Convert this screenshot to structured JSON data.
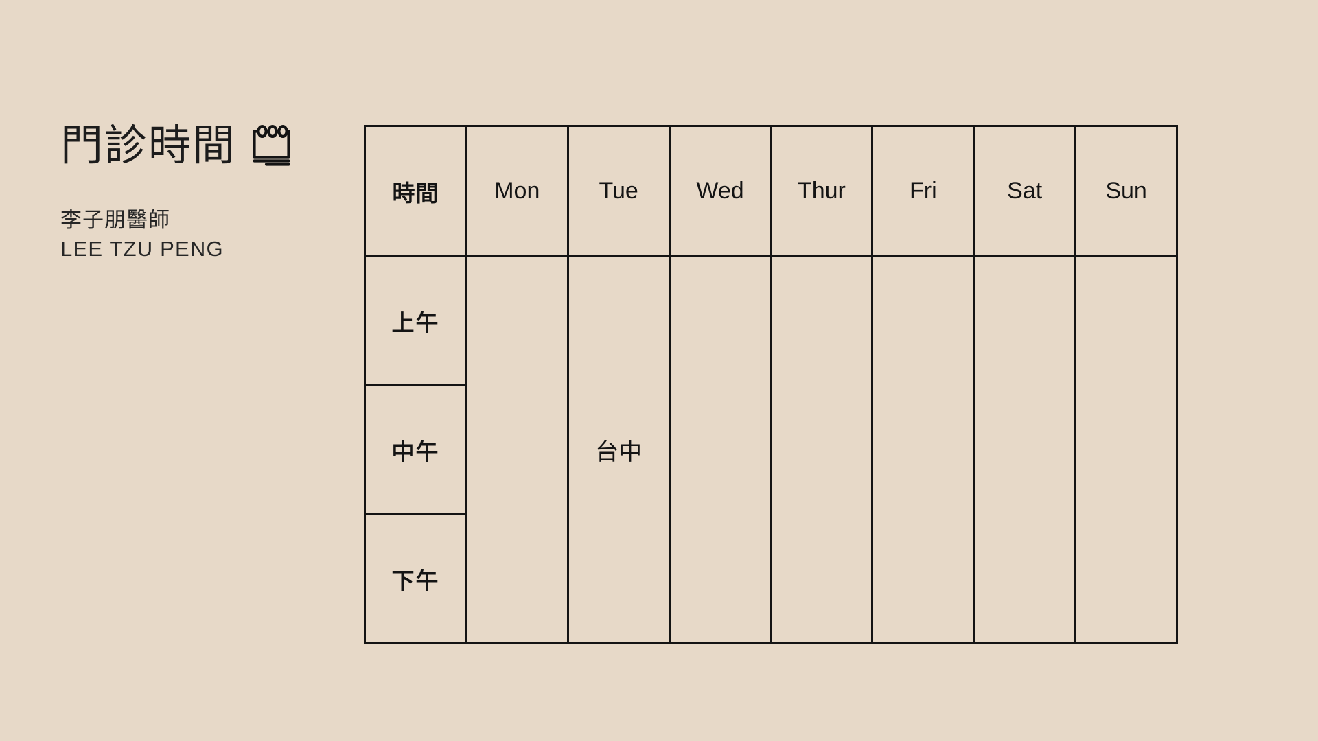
{
  "page": {
    "background_color": "#e7d9c8",
    "ink_color": "#141414"
  },
  "header": {
    "title": "門診時間",
    "icon": "notepad-calendar-icon",
    "doctor_name_zh": "李子朋醫師",
    "doctor_name_en": "LEE TZU PENG"
  },
  "schedule": {
    "columns": [
      {
        "key": "time",
        "label": "時間"
      },
      {
        "key": "mon",
        "label": "Mon"
      },
      {
        "key": "tue",
        "label": "Tue"
      },
      {
        "key": "wed",
        "label": "Wed"
      },
      {
        "key": "thur",
        "label": "Thur"
      },
      {
        "key": "fri",
        "label": "Fri"
      },
      {
        "key": "sat",
        "label": "Sat"
      },
      {
        "key": "sun",
        "label": "Sun"
      }
    ],
    "rows": [
      {
        "label": "上午",
        "cells": {
          "mon": "",
          "tue": "",
          "wed": "",
          "thur": "",
          "fri": "",
          "sat": "",
          "sun": ""
        }
      },
      {
        "label": "中午",
        "cells": {
          "mon": "",
          "tue": "台中",
          "wed": "",
          "thur": "",
          "fri": "",
          "sat": "",
          "sun": ""
        }
      },
      {
        "label": "下午",
        "cells": {
          "mon": "",
          "tue": "",
          "wed": "",
          "thur": "",
          "fri": "",
          "sat": "",
          "sun": ""
        }
      }
    ]
  }
}
